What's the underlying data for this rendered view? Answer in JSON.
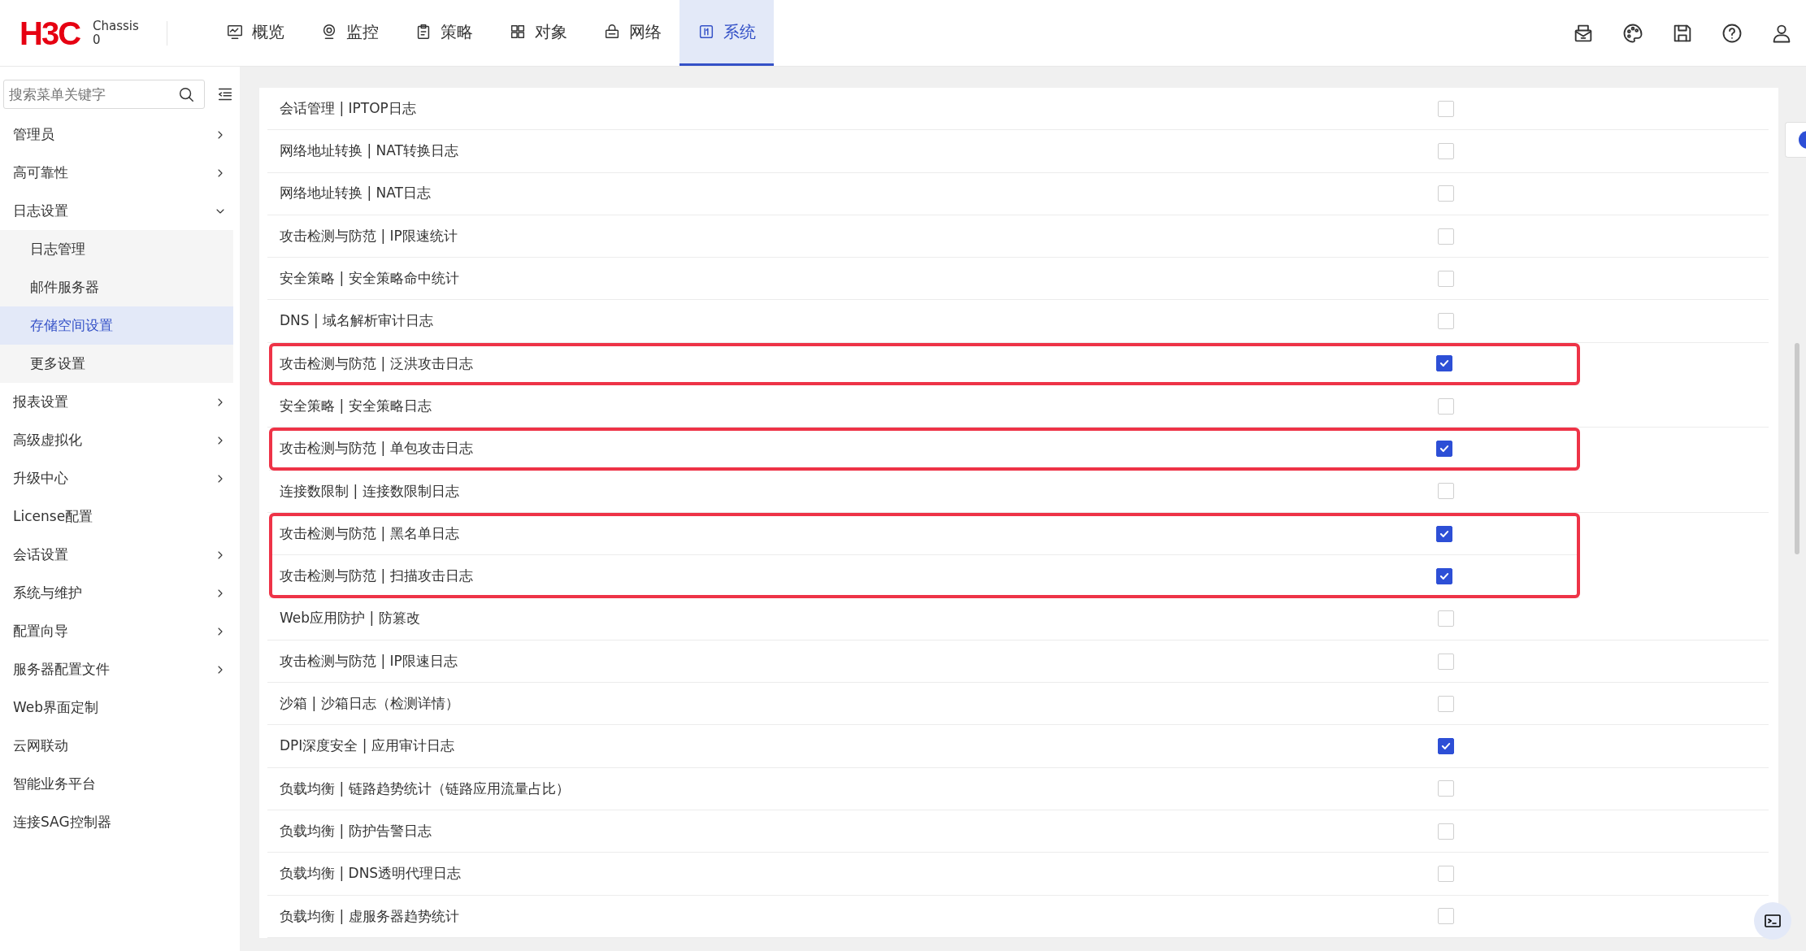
{
  "header": {
    "logo": "H3C",
    "device": [
      "Chassis",
      "0"
    ],
    "tabs": [
      {
        "label": "概览",
        "selected": false
      },
      {
        "label": "监控",
        "selected": false
      },
      {
        "label": "策略",
        "selected": false
      },
      {
        "label": "对象",
        "selected": false
      },
      {
        "label": "网络",
        "selected": false
      },
      {
        "label": "系统",
        "selected": true
      }
    ]
  },
  "sidebar": {
    "search": {
      "placeholder": "搜索菜单关键字"
    },
    "items": [
      {
        "label": "管理员",
        "kind": "group",
        "expanded": false
      },
      {
        "label": "高可靠性",
        "kind": "group",
        "expanded": false
      },
      {
        "label": "日志设置",
        "kind": "group",
        "expanded": true,
        "children": [
          {
            "label": "日志管理",
            "selected": false
          },
          {
            "label": "邮件服务器",
            "selected": false
          },
          {
            "label": "存储空间设置",
            "selected": true
          },
          {
            "label": "更多设置",
            "selected": false
          }
        ]
      },
      {
        "label": "报表设置",
        "kind": "group",
        "expanded": false
      },
      {
        "label": "高级虚拟化",
        "kind": "group",
        "expanded": false
      },
      {
        "label": "升级中心",
        "kind": "group",
        "expanded": false
      },
      {
        "label": "License配置",
        "kind": "link"
      },
      {
        "label": "会话设置",
        "kind": "group",
        "expanded": false
      },
      {
        "label": "系统与维护",
        "kind": "group",
        "expanded": false
      },
      {
        "label": "配置向导",
        "kind": "group",
        "expanded": false
      },
      {
        "label": "服务器配置文件",
        "kind": "group",
        "expanded": false
      },
      {
        "label": "Web界面定制",
        "kind": "link"
      },
      {
        "label": "云网联动",
        "kind": "link"
      },
      {
        "label": "智能业务平台",
        "kind": "link"
      },
      {
        "label": "连接SAG控制器",
        "kind": "link"
      }
    ]
  },
  "sections": [
    {
      "highlighted": false,
      "rows": [
        {
          "label": "会话管理 | IPTOP日志",
          "checked": false
        },
        {
          "label": "网络地址转换 | NAT转换日志",
          "checked": false
        },
        {
          "label": "网络地址转换 | NAT日志",
          "checked": false
        },
        {
          "label": "攻击检测与防范 | IP限速统计",
          "checked": false
        },
        {
          "label": "安全策略 | 安全策略命中统计",
          "checked": false
        },
        {
          "label": "DNS | 域名解析审计日志",
          "checked": false
        }
      ]
    },
    {
      "highlighted": true,
      "rows": [
        {
          "label": "攻击检测与防范 | 泛洪攻击日志",
          "checked": true
        }
      ]
    },
    {
      "highlighted": false,
      "rows": [
        {
          "label": "安全策略 | 安全策略日志",
          "checked": false
        }
      ]
    },
    {
      "highlighted": true,
      "rows": [
        {
          "label": "攻击检测与防范 | 单包攻击日志",
          "checked": true
        }
      ]
    },
    {
      "highlighted": false,
      "rows": [
        {
          "label": "连接数限制 | 连接数限制日志",
          "checked": false
        }
      ]
    },
    {
      "highlighted": true,
      "rows": [
        {
          "label": "攻击检测与防范 | 黑名单日志",
          "checked": true
        },
        {
          "label": "攻击检测与防范 | 扫描攻击日志",
          "checked": true
        }
      ]
    },
    {
      "highlighted": false,
      "rows": [
        {
          "label": "Web应用防护 | 防篡改",
          "checked": false
        },
        {
          "label": "攻击检测与防范 | IP限速日志",
          "checked": false
        },
        {
          "label": "沙箱 | 沙箱日志（检测详情）",
          "checked": false
        },
        {
          "label": "DPI深度安全 | 应用审计日志",
          "checked": true
        },
        {
          "label": "负载均衡 | 链路趋势统计（链路应用流量占比）",
          "checked": false
        },
        {
          "label": "负载均衡 | 防护告警日志",
          "checked": false
        },
        {
          "label": "负载均衡 | DNS透明代理日志",
          "checked": false
        },
        {
          "label": "负载均衡 | 虚服务器趋势统计",
          "checked": false
        }
      ]
    }
  ]
}
